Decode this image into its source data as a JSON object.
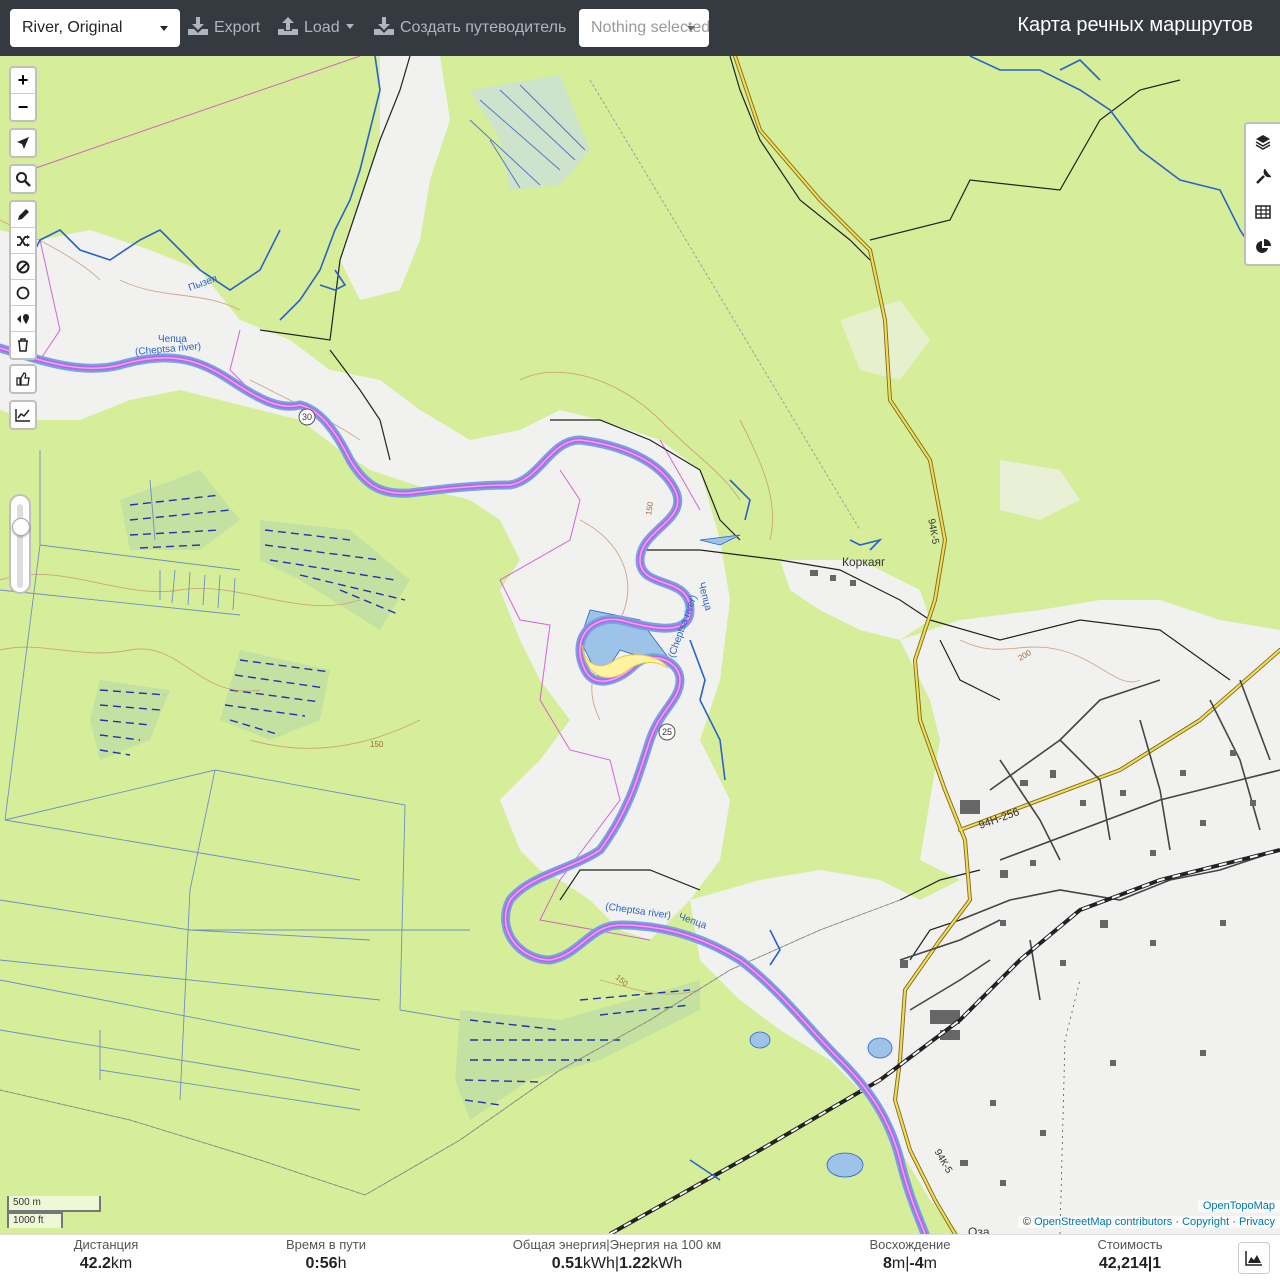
{
  "toolbar": {
    "profile_select": "River, Original",
    "export_label": "Export",
    "load_label": "Load",
    "guide_label": "Создать путеводитель",
    "selection_placeholder": "Nothing selected",
    "brand_title": "Карта речных маршрутов"
  },
  "map_controls": {
    "zoom_in": "+",
    "zoom_out": "−",
    "icons": [
      "locate-arrow-icon",
      "search-icon",
      "pencil-icon",
      "shuffle-icon",
      "ban-icon",
      "circle-icon",
      "reverse-marker-icon",
      "trash-icon",
      "thumbs-up-icon",
      "chart-line-icon"
    ]
  },
  "right_controls": [
    "layers-icon",
    "wrench-icon",
    "table-icon",
    "pie-chart-icon"
  ],
  "map_labels": {
    "pyzep": "Пызеп",
    "chepca_top": "Чепца",
    "cheptsa_river_top": "(Cheptsa river)",
    "korkayag": "Коркаяг",
    "chepca_mid": "Чепца",
    "cheptsa_river_mid": "(Cheptsa river)",
    "cheptsa_river_bottom": "(Cheptsa river)",
    "chepca_bottom": "Чепца",
    "road_94k5": "94К-5",
    "road_94k5_bottom": "94К-5",
    "road_94n256": "94Н-256",
    "marker_30": "30",
    "marker_25": "25",
    "contour_150a": "150",
    "contour_150b": "150",
    "contour_150c": "150",
    "contour_200": "200",
    "contour_150d": "150",
    "oza": "Оза"
  },
  "scale": {
    "metric": "500 m",
    "imperial": "1000 ft"
  },
  "attribution": {
    "provider": "OpenTopoMap",
    "copyright_prefix": "©",
    "osm": "OpenStreetMap contributors",
    "separator": "·",
    "copyright": "Copyright",
    "privacy": "Privacy"
  },
  "stats": {
    "distance": {
      "label": "Дистанция",
      "value": "42.2",
      "unit": "km"
    },
    "travel_time": {
      "label": "Время в пути",
      "value": "0:56",
      "unit": "h"
    },
    "energy": {
      "label": "Общая энергия|Энергия на 100 км",
      "value1": "0.51",
      "unit1": "kWh",
      "value2": "1.22",
      "unit2": "kWh"
    },
    "ascent": {
      "label": "Восхождение",
      "value1": "8",
      "unit1": "m",
      "value2": "-4",
      "unit2": "m"
    },
    "cost": {
      "label": "Стоимость",
      "value": "42,214|1"
    }
  },
  "colors": {
    "topbar": "#343a40",
    "forest": "#d6ee9a",
    "clearing": "#f2f2f2",
    "river": "#2a62c9",
    "route": "#cc66ee",
    "road_major": "#f2d24a"
  }
}
